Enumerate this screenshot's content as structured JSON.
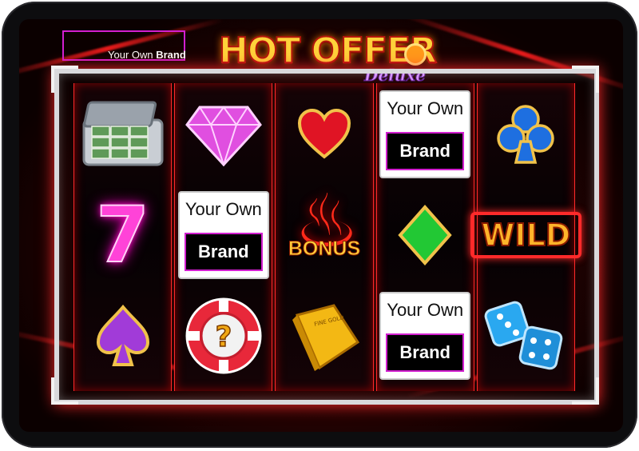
{
  "brand_placeholder": {
    "prefix": "Your Own ",
    "bold": "Brand"
  },
  "logo": {
    "title": "HOT OFFER",
    "subtitle": "Deluxe"
  },
  "reels": [
    [
      {
        "type": "icon",
        "icon": "money-briefcase-icon"
      },
      {
        "type": "icon",
        "icon": "lucky-seven-icon",
        "label": "7"
      },
      {
        "type": "icon",
        "icon": "spade-icon"
      }
    ],
    [
      {
        "type": "icon",
        "icon": "diamond-gem-icon"
      },
      {
        "type": "brand",
        "line1": "Your Own",
        "line2": "Brand"
      },
      {
        "type": "icon",
        "icon": "mystery-chip-icon",
        "label": "?"
      }
    ],
    [
      {
        "type": "icon",
        "icon": "heart-icon"
      },
      {
        "type": "bonus",
        "icon": "bonus-flame-icon",
        "label": "BONUS"
      },
      {
        "type": "icon",
        "icon": "gold-bar-icon",
        "label": "FINE GOLD"
      }
    ],
    [
      {
        "type": "brand",
        "line1": "Your Own",
        "line2": "Brand"
      },
      {
        "type": "icon",
        "icon": "diamond-suit-icon"
      },
      {
        "type": "brand",
        "line1": "Your Own",
        "line2": "Brand"
      }
    ],
    [
      {
        "type": "icon",
        "icon": "club-icon"
      },
      {
        "type": "wild",
        "icon": "wild-icon",
        "label": "WILD"
      },
      {
        "type": "icon",
        "icon": "dice-icon"
      }
    ]
  ]
}
